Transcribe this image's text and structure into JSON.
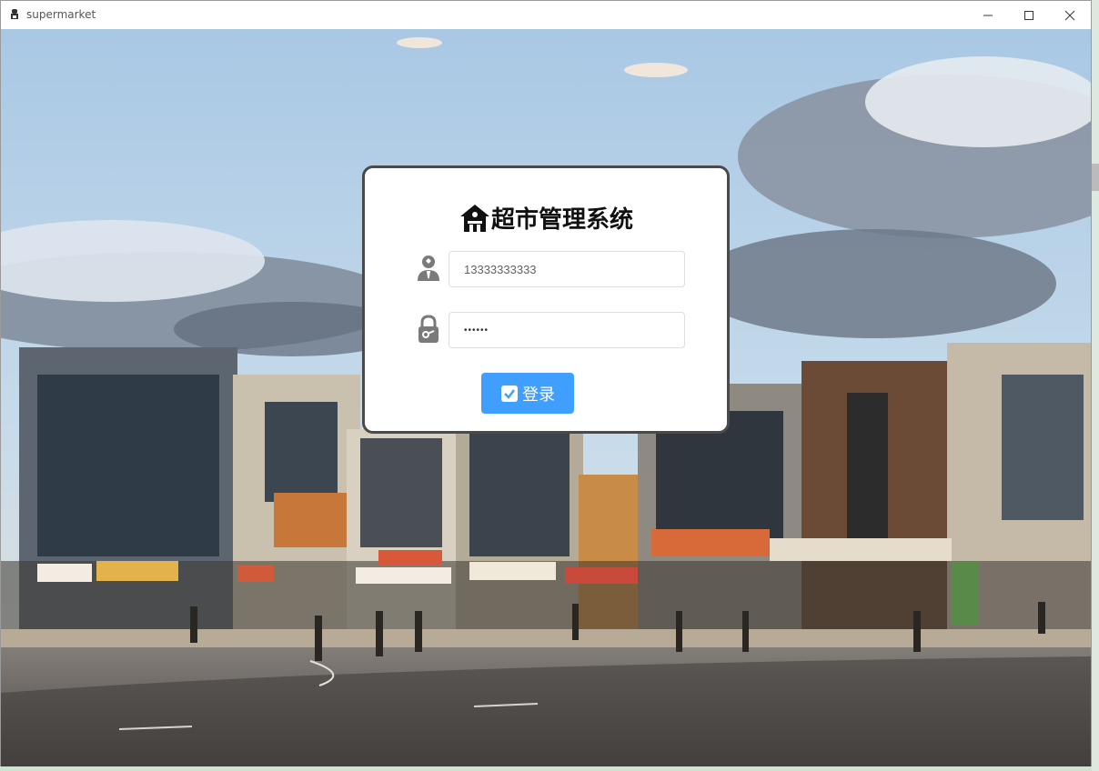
{
  "window": {
    "title": "supermarket",
    "controls": {
      "minimize": "minimize-icon",
      "maximize": "maximize-icon",
      "close": "close-icon"
    }
  },
  "login": {
    "title": "超市管理系统",
    "title_icon": "house-icon",
    "username_icon": "user-icon",
    "username_value": "13333333333",
    "password_icon": "lock-icon",
    "password_value": "••••••",
    "submit_icon": "checkbox-icon",
    "submit_label": "登录"
  },
  "colors": {
    "accent": "#409eff",
    "card_border": "#4a4a4a"
  }
}
